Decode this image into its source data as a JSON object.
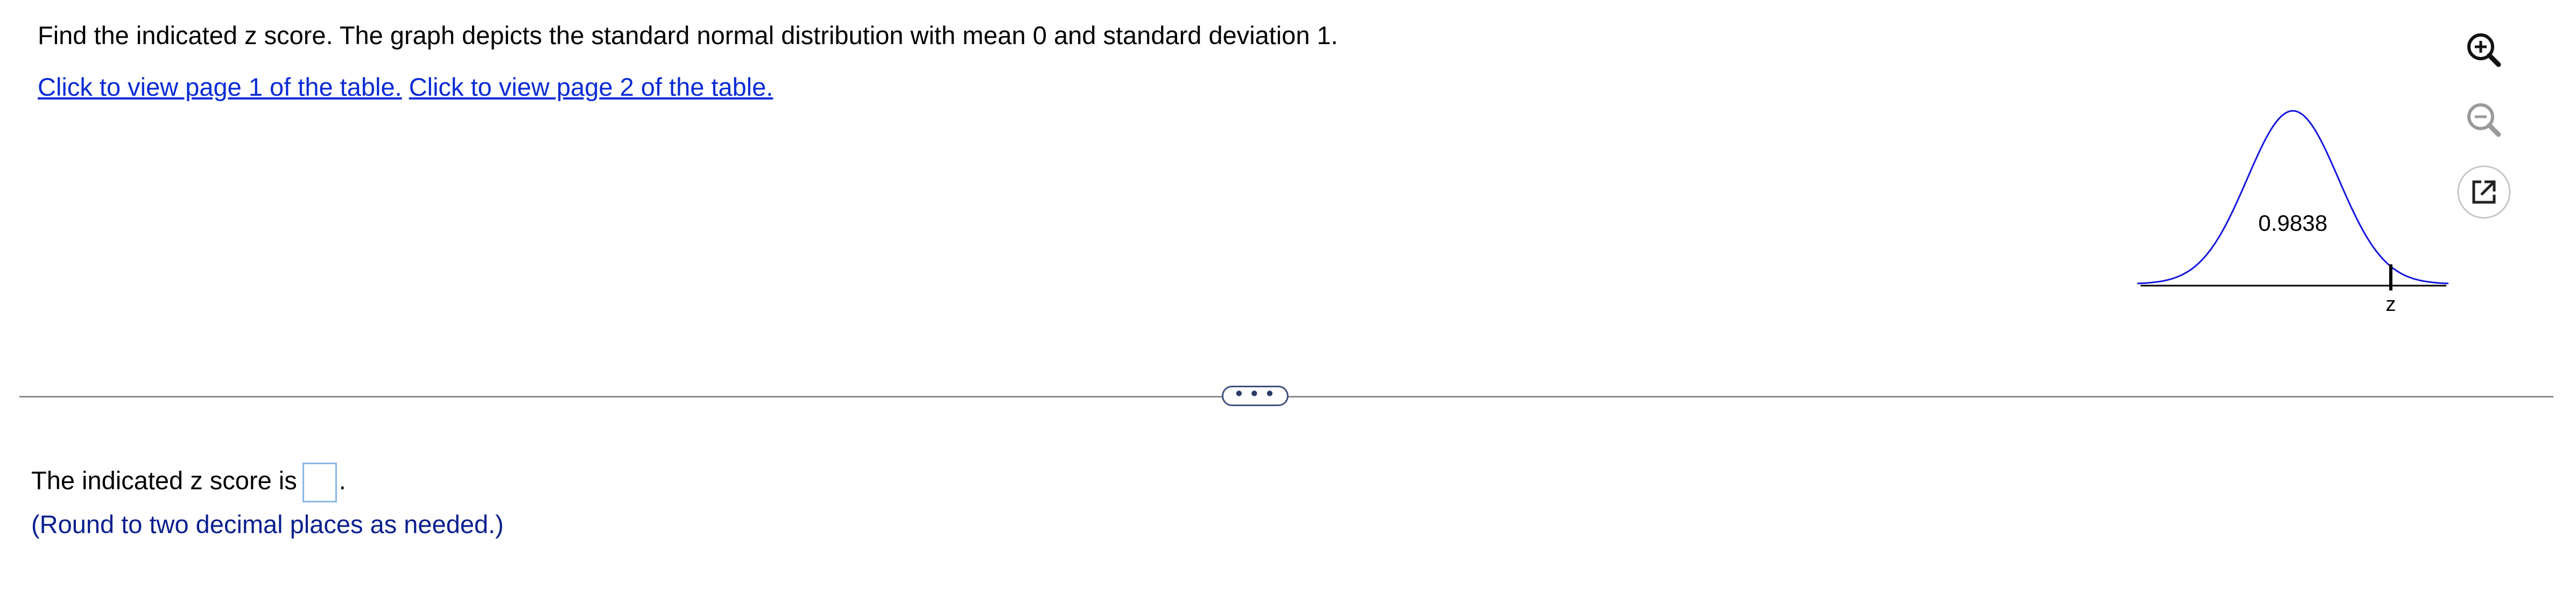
{
  "question": {
    "text": "Find the indicated z score. The graph depicts the standard normal distribution with mean 0 and standard deviation 1."
  },
  "links": {
    "page1": "Click to view page 1 of the table.",
    "page2": "Click to view page 2 of the table."
  },
  "graph": {
    "area_label": "0.9838",
    "z_label": "z",
    "curve_color": "#1515e0",
    "mean": 0,
    "sd": 1
  },
  "toolbar": {
    "zoom_in": "zoom-in-icon",
    "zoom_out": "zoom-out-icon",
    "popout": "popout-icon"
  },
  "expander": {
    "label": "• • •"
  },
  "answer": {
    "prefix": "The indicated z score is",
    "value": "",
    "suffix": "."
  },
  "hint": {
    "text": "(Round to two decimal places as needed.)"
  }
}
